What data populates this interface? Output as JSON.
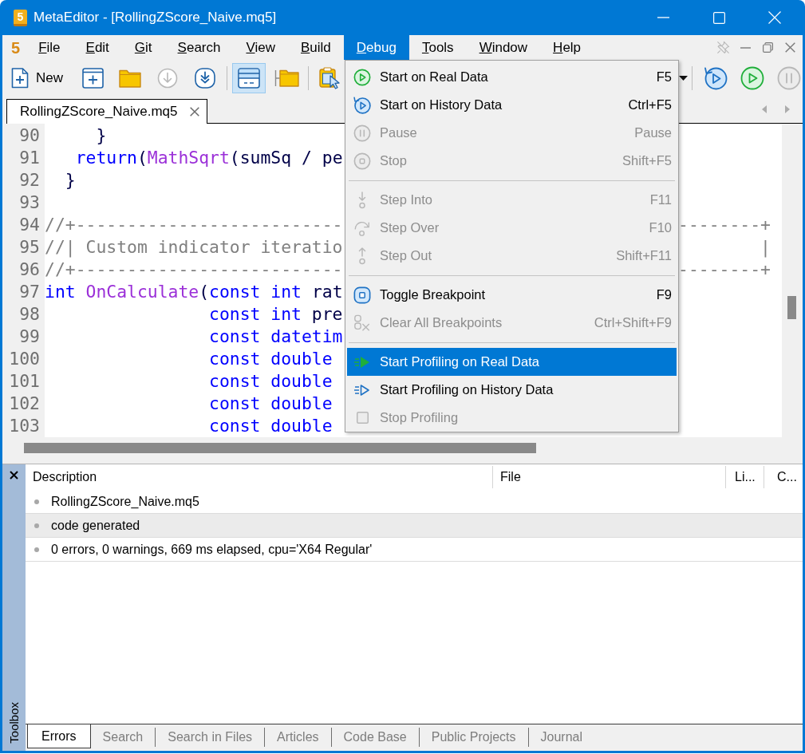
{
  "window": {
    "logo_text": "5",
    "title": "MetaEditor - [RollingZScore_Naive.mq5]"
  },
  "menubar": {
    "document_icon_text": "5",
    "items": [
      {
        "label": "File",
        "selected": false
      },
      {
        "label": "Edit",
        "selected": false
      },
      {
        "label": "Git",
        "selected": false
      },
      {
        "label": "Search",
        "selected": false
      },
      {
        "label": "View",
        "selected": false
      },
      {
        "label": "Build",
        "selected": false
      },
      {
        "label": "Debug",
        "selected": true
      },
      {
        "label": "Tools",
        "selected": false
      },
      {
        "label": "Window",
        "selected": false
      },
      {
        "label": "Help",
        "selected": false
      }
    ]
  },
  "toolbar": {
    "left": [
      {
        "kind": "button",
        "label": "New",
        "selected": false,
        "disabled": false
      },
      {
        "kind": "button",
        "selected": false,
        "disabled": false
      },
      {
        "kind": "button",
        "selected": false,
        "disabled": false
      },
      {
        "kind": "button",
        "selected": false,
        "disabled": true
      },
      {
        "kind": "button",
        "selected": false,
        "disabled": false
      },
      {
        "kind": "separator"
      },
      {
        "kind": "button",
        "selected": true,
        "disabled": false
      },
      {
        "kind": "button",
        "selected": false,
        "disabled": false
      },
      {
        "kind": "separator"
      },
      {
        "kind": "button",
        "selected": false,
        "disabled": false
      }
    ],
    "right": [
      {
        "kind": "caret"
      },
      {
        "kind": "separator"
      },
      {
        "kind": "button",
        "disabled": false
      },
      {
        "kind": "button",
        "disabled": false
      },
      {
        "kind": "button",
        "disabled": true
      }
    ]
  },
  "editor": {
    "tabs": [
      {
        "label": "RollingZScore_Naive.mq5",
        "selected": true
      }
    ],
    "lines": [
      {
        "number": "90",
        "code": [
          {
            "kind": "plain",
            "text": "     }"
          }
        ]
      },
      {
        "number": "91",
        "code": [
          {
            "kind": "keyword",
            "text": "   return"
          },
          {
            "kind": "plain",
            "text": "("
          },
          {
            "kind": "function",
            "text": "MathSqrt"
          },
          {
            "kind": "plain",
            "text": "(sumSq / pe"
          }
        ]
      },
      {
        "number": "92",
        "code": [
          {
            "kind": "plain",
            "text": "  }"
          }
        ]
      },
      {
        "number": "93"
      },
      {
        "number": "94",
        "code": [
          {
            "kind": "comment",
            "text": "//+--------------------------"
          }
        ],
        "right": [
          {
            "kind": "comment",
            "text": "--------+"
          }
        ]
      },
      {
        "number": "95",
        "code": [
          {
            "kind": "comment",
            "text": "//| Custom indicator iteratio"
          }
        ],
        "right": [
          {
            "kind": "comment",
            "text": "|"
          }
        ]
      },
      {
        "number": "96",
        "code": [
          {
            "kind": "comment",
            "text": "//+--------------------------"
          }
        ],
        "right": [
          {
            "kind": "comment",
            "text": "--------+"
          }
        ]
      },
      {
        "number": "97",
        "code": [
          {
            "kind": "keyword",
            "text": "int "
          },
          {
            "kind": "function",
            "text": "OnCalculate"
          },
          {
            "kind": "plain",
            "text": "("
          },
          {
            "kind": "keyword",
            "text": "const int "
          },
          {
            "kind": "plain",
            "text": "rat"
          }
        ]
      },
      {
        "number": "98",
        "code": [
          {
            "kind": "keyword",
            "text": "                const int "
          },
          {
            "kind": "plain",
            "text": "pre"
          }
        ]
      },
      {
        "number": "99",
        "code": [
          {
            "kind": "keyword",
            "text": "                const datetim"
          }
        ]
      },
      {
        "number": "100",
        "code": [
          {
            "kind": "keyword",
            "text": "                const double"
          }
        ]
      },
      {
        "number": "101",
        "code": [
          {
            "kind": "keyword",
            "text": "                const double"
          }
        ]
      },
      {
        "number": "102",
        "code": [
          {
            "kind": "keyword",
            "text": "                const double"
          }
        ]
      },
      {
        "number": "103",
        "code": [
          {
            "kind": "keyword",
            "text": "                const double"
          }
        ]
      }
    ]
  },
  "debug_menu": {
    "items": [
      {
        "kind": "item",
        "label": "Start on Real Data",
        "shortcut": "F5",
        "disabled": false,
        "selected": false
      },
      {
        "kind": "item",
        "label": "Start on History Data",
        "shortcut": "Ctrl+F5",
        "disabled": false,
        "selected": false
      },
      {
        "kind": "item",
        "label": "Pause",
        "shortcut": "Pause",
        "disabled": true,
        "selected": false
      },
      {
        "kind": "item",
        "label": "Stop",
        "shortcut": "Shift+F5",
        "disabled": true,
        "selected": false
      },
      {
        "kind": "separator"
      },
      {
        "kind": "item",
        "label": "Step Into",
        "shortcut": "F11",
        "disabled": true,
        "selected": false
      },
      {
        "kind": "item",
        "label": "Step Over",
        "shortcut": "F10",
        "disabled": true,
        "selected": false
      },
      {
        "kind": "item",
        "label": "Step Out",
        "shortcut": "Shift+F11",
        "disabled": true,
        "selected": false
      },
      {
        "kind": "separator"
      },
      {
        "kind": "item",
        "label": "Toggle Breakpoint",
        "shortcut": "F9",
        "disabled": false,
        "selected": false
      },
      {
        "kind": "item",
        "label": "Clear All Breakpoints",
        "shortcut": "Ctrl+Shift+F9",
        "disabled": true,
        "selected": false
      },
      {
        "kind": "separator"
      },
      {
        "kind": "item",
        "label": "Start Profiling on Real Data",
        "disabled": false,
        "selected": true
      },
      {
        "kind": "item",
        "label": "Start Profiling on History Data",
        "disabled": false,
        "selected": false
      },
      {
        "kind": "item",
        "label": "Stop Profiling",
        "disabled": true,
        "selected": false
      }
    ]
  },
  "toolbox": {
    "title": "Toolbox",
    "columns": [
      "Description",
      "File",
      "Li...",
      "C..."
    ],
    "rows": [
      {
        "description": "RollingZScore_Naive.mq5",
        "selected": false
      },
      {
        "description": "code generated",
        "selected": true
      },
      {
        "description": "0 errors, 0 warnings, 669 ms elapsed, cpu='X64 Regular'",
        "selected": false
      }
    ],
    "tabs": [
      {
        "label": "Errors",
        "selected": true
      },
      {
        "label": "Search",
        "selected": false
      },
      {
        "label": "Search in Files",
        "selected": false
      },
      {
        "label": "Articles",
        "selected": false
      },
      {
        "label": "Code Base",
        "selected": false
      },
      {
        "label": "Public Projects",
        "selected": false
      },
      {
        "label": "Journal",
        "selected": false
      }
    ]
  }
}
